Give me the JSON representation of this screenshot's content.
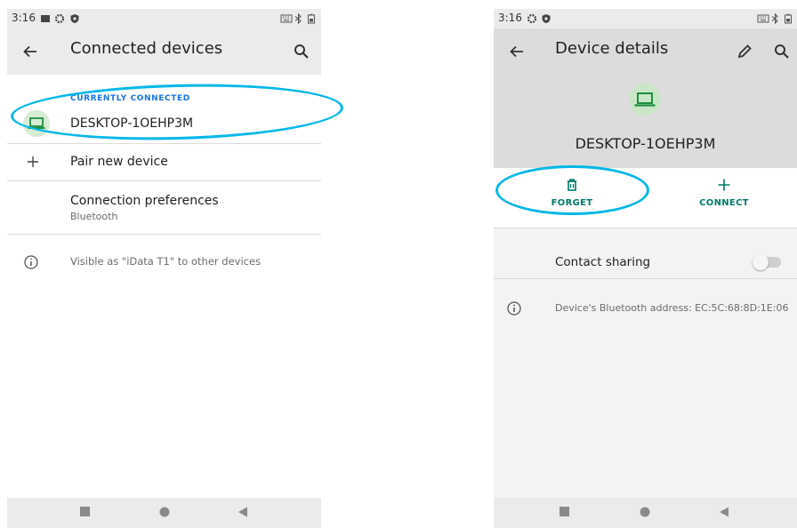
{
  "left_screen": {
    "status_time": "3:16",
    "appbar_title": "Connected devices",
    "section_header": "CURRENTLY CONNECTED",
    "connected_device": "DESKTOP-1OEHP3M",
    "pair_label": "Pair new device",
    "pref_label": "Connection preferences",
    "pref_sub": "Bluetooth",
    "visible_text": "Visible as \"iData T1\" to other devices"
  },
  "right_screen": {
    "status_time": "3:16",
    "appbar_title": "Device details",
    "device_name": "DESKTOP-1OEHP3M",
    "forget_label": "FORGET",
    "connect_label": "CONNECT",
    "contact_sharing_label": "Contact sharing",
    "contact_sharing_on": false,
    "address_text": "Device's Bluetooth address: EC:5C:68:8D:1E:06"
  },
  "icons": {
    "back": "arrow-back-icon",
    "search": "search-icon",
    "edit": "pencil-icon",
    "laptop": "laptop-icon",
    "plus": "plus-icon",
    "info": "info-icon",
    "trash": "trash-icon",
    "nav_square": "recents-icon",
    "nav_circle": "home-icon",
    "nav_triangle": "back-nav-icon"
  },
  "colors": {
    "accent_blue": "#1a73e8",
    "accent_teal": "#00796b",
    "annotation": "#00b7e8",
    "device_icon": "#1e8e3e"
  }
}
